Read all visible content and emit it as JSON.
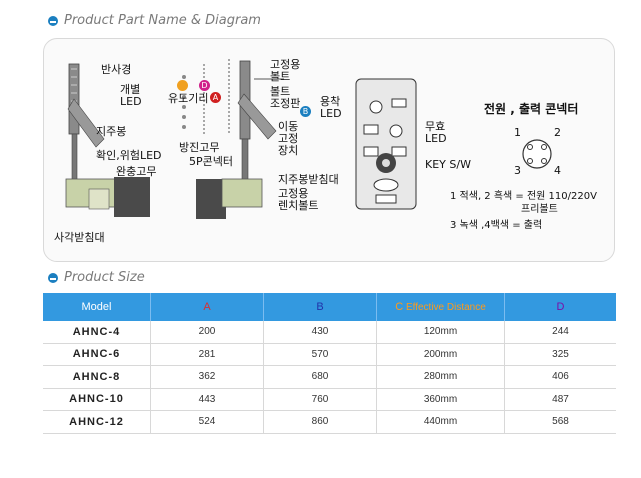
{
  "sections": {
    "diagram_title": "Product Part Name & Diagram",
    "size_title": "Product Size"
  },
  "diagram": {
    "labels": {
      "reflector": "반사경",
      "individual_led": "개별\nLED",
      "inductor": "유도기리",
      "support_rod": "지주봉",
      "confirm_warning_led": "확인,위험LED",
      "buffer_rubber": "완충고무",
      "square_stand": "사각받침대",
      "anti_vibration_rubber": "방진고무",
      "connector_5p": "5P콘넥터",
      "fixing_bolt_top": "고정용\n볼트",
      "bolt_adjust_plate": "볼트\n조정판",
      "moving_fixture": "이동\n고정\n장치",
      "rod_stand": "지주봉받침대",
      "fixing_wrench_bolt": "고정용\n렌치볼트",
      "weld_led": "용착\nLED",
      "invalid_led": "무효\nLED",
      "key_switch": "KEY S/W"
    },
    "markers": {
      "a": "A",
      "b": "B",
      "c": "C",
      "d": "D"
    },
    "connector": {
      "title": "전원 , 출력 콘넥터",
      "pins": [
        "1",
        "2",
        "3",
        "4"
      ],
      "note1": "1 적색, 2 흑색 = 전원 110/220V",
      "note1b": "프리볼트",
      "note2": "3 녹색 ,4백색 = 출력"
    }
  },
  "table": {
    "headers": {
      "model": "Model",
      "a": "A",
      "b": "B",
      "c_letter": "C",
      "c_text": "Effective Distance",
      "d": "D"
    },
    "rows": [
      {
        "model": "AHNC-4",
        "a": "200",
        "b": "430",
        "c": "120mm",
        "d": "244"
      },
      {
        "model": "AHNC-6",
        "a": "281",
        "b": "570",
        "c": "200mm",
        "d": "325"
      },
      {
        "model": "AHNC-8",
        "a": "362",
        "b": "680",
        "c": "280mm",
        "d": "406"
      },
      {
        "model": "AHNC-10",
        "a": "443",
        "b": "760",
        "c": "360mm",
        "d": "487"
      },
      {
        "model": "AHNC-12",
        "a": "524",
        "b": "860",
        "c": "440mm",
        "d": "568"
      }
    ]
  },
  "colors": {
    "header_bg": "#3399e0",
    "a": "#d93030",
    "b": "#2233aa",
    "c": "#ff9a1a",
    "d": "#7a0fa8"
  }
}
